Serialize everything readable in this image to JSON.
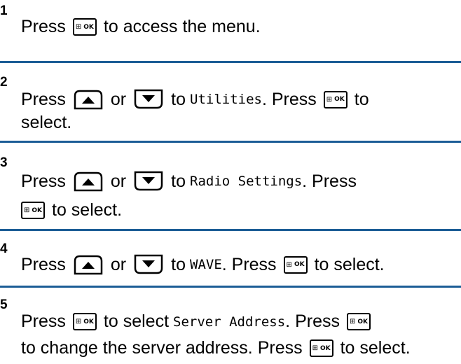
{
  "steps": [
    {
      "number": "1",
      "lines": [
        [
          "Press",
          "{ok}",
          "to access the menu."
        ]
      ]
    },
    {
      "number": "2",
      "lines": [
        [
          "Press",
          "{up}",
          "or",
          "{down}",
          "to",
          "Utilities",
          ". Press",
          "{ok}",
          "to"
        ],
        [
          "select."
        ]
      ]
    },
    {
      "number": "3",
      "lines": [
        [
          "Press",
          "{up}",
          "or",
          "{down}",
          "to",
          "Radio Settings",
          ". Press"
        ],
        [
          "{ok}",
          "to select."
        ]
      ]
    },
    {
      "number": "4",
      "lines": [
        [
          "Press",
          "{up}",
          "or",
          "{down}",
          "to",
          "WAVE",
          ". Press",
          "{ok}",
          "to select."
        ]
      ]
    },
    {
      "number": "5",
      "lines": [
        [
          "Press",
          "{ok}",
          "to select",
          "Server Address",
          ". Press",
          "{ok}"
        ],
        [
          "to change the server address. Press",
          "{ok}",
          "to select."
        ]
      ]
    }
  ],
  "keys": {
    "ok_label": "OK",
    "ok_grid": "⊞"
  },
  "colors": {
    "separator": "#1c5d96"
  }
}
